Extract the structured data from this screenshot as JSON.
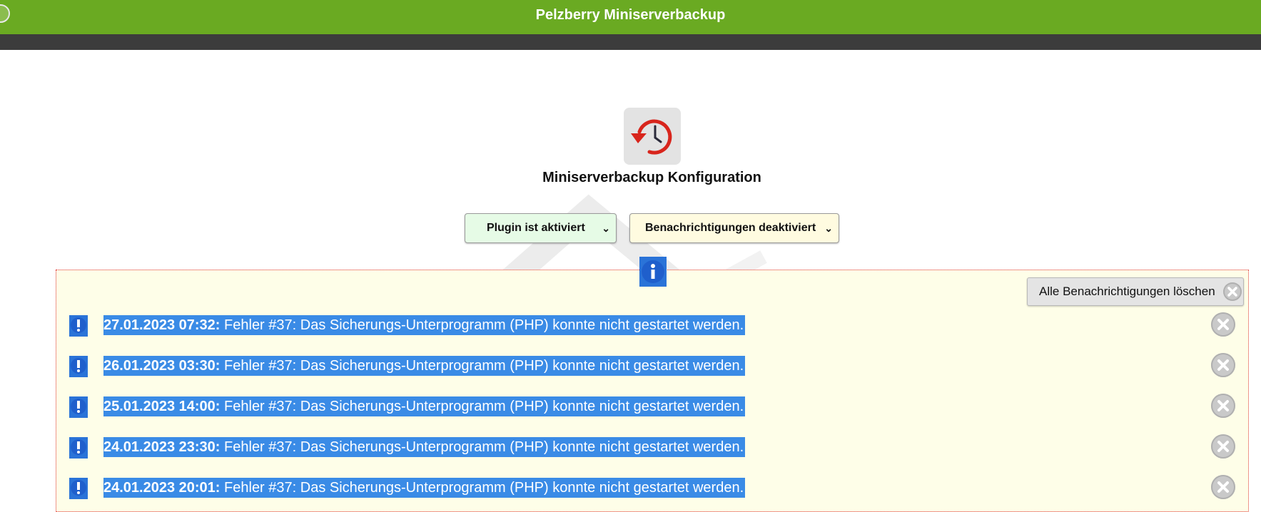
{
  "header": {
    "title": "Pelzberry Miniserverbackup"
  },
  "main": {
    "title": "Miniserverbackup Konfiguration",
    "plugin_select": {
      "value": "Plugin ist aktiviert"
    },
    "notify_select": {
      "value": "Benachrichtigungen deaktiviert"
    },
    "clear_all_label": "Alle Benachrichtigungen löschen"
  },
  "notifications": [
    {
      "timestamp": "27.01.2023 07:32:",
      "text": "Fehler #37: Das Sicherungs-Unterprogramm (PHP) konnte nicht gestartet werden."
    },
    {
      "timestamp": "26.01.2023 03:30:",
      "text": "Fehler #37: Das Sicherungs-Unterprogramm (PHP) konnte nicht gestartet werden."
    },
    {
      "timestamp": "25.01.2023 14:00:",
      "text": "Fehler #37: Das Sicherungs-Unterprogramm (PHP) konnte nicht gestartet werden."
    },
    {
      "timestamp": "24.01.2023 23:30:",
      "text": "Fehler #37: Das Sicherungs-Unterprogramm (PHP) konnte nicht gestartet werden."
    },
    {
      "timestamp": "24.01.2023 20:01:",
      "text": "Fehler #37: Das Sicherungs-Unterprogramm (PHP) konnte nicht gestartet werden."
    }
  ],
  "icons": {
    "plugin": "backup-clock-icon",
    "info": "info-icon",
    "notification": "exclamation-icon",
    "delete": "close-circle-icon"
  },
  "colors": {
    "header_bg": "#6aaa22",
    "subbar_bg": "#3c3c3c",
    "selection_bg": "#3a8be6",
    "box_bg": "#fefee8",
    "box_border": "#e03030"
  }
}
